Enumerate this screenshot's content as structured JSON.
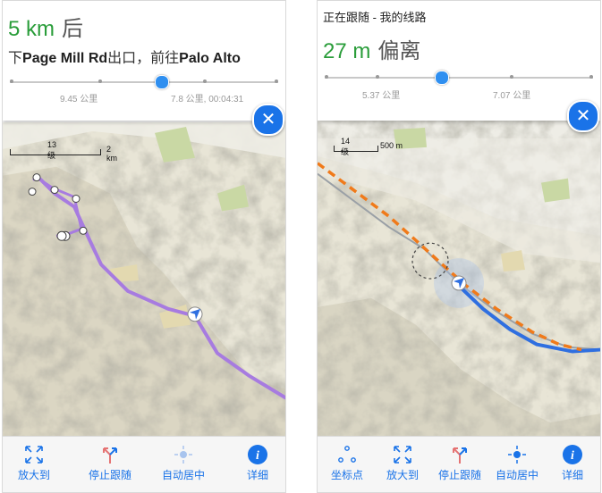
{
  "screen1": {
    "distance_value": "5 km",
    "distance_direction": "后",
    "instruction_prefix": "下",
    "instruction_road": "Page Mill Rd",
    "instruction_middle": "出口，前往",
    "instruction_dest": "Palo Alto",
    "slider_progress": 0.55,
    "slider_left_label": "9.45 公里",
    "slider_right_label": "7.8 公里, 00:04:31",
    "scale_level": "13 级",
    "scale_distance": "2 km",
    "toolbar": [
      {
        "icon": "zoom-fit-icon",
        "label": "放大到"
      },
      {
        "icon": "stop-follow-icon",
        "label": "停止跟随"
      },
      {
        "icon": "auto-center-icon",
        "label": "自动居中"
      },
      {
        "icon": "info-icon",
        "label": "详细"
      }
    ]
  },
  "screen2": {
    "tracking_title": "正在跟随 - 我的线路",
    "distance_value": "27 m",
    "distance_direction": "偏离",
    "slider_progress": 0.43,
    "slider_left_label": "5.37 公里",
    "slider_right_label": "7.07 公里",
    "scale_level": "14 级",
    "scale_distance": "500 m",
    "toolbar": [
      {
        "icon": "waypoints-icon",
        "label": "坐标点"
      },
      {
        "icon": "zoom-fit-icon",
        "label": "放大到"
      },
      {
        "icon": "stop-follow-icon",
        "label": "停止跟随"
      },
      {
        "icon": "auto-center-icon",
        "label": "自动居中"
      },
      {
        "icon": "info-icon",
        "label": "详细"
      }
    ]
  },
  "colors": {
    "accent_blue": "#1a73e8",
    "distance_green": "#2a9d3a",
    "route_purple": "#a77be0",
    "route_orange": "#f07a1a",
    "track_blue": "#2f6fe0",
    "terrain": "#e6e3d4",
    "park_green": "#c9d8a4"
  }
}
